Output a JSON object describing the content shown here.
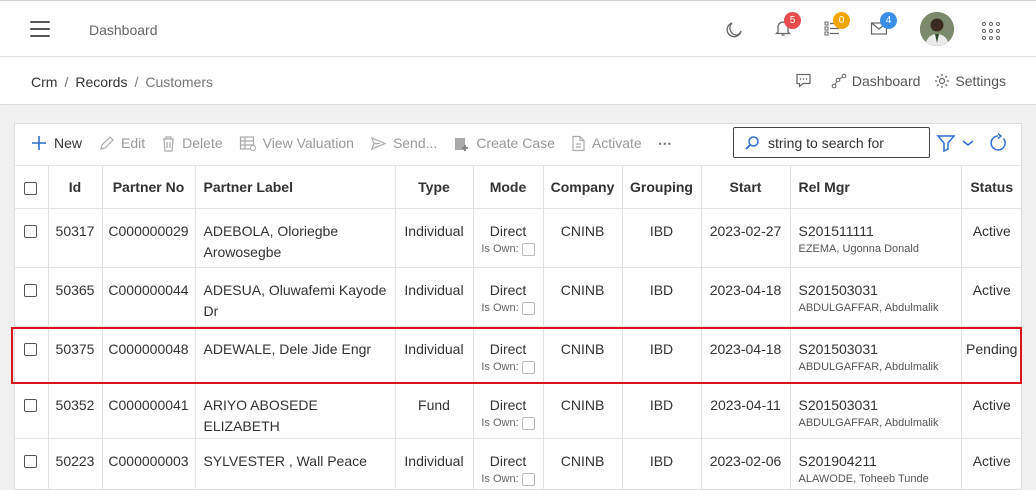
{
  "header": {
    "title": "Dashboard",
    "notifications_count": "5",
    "tasks_count": "0",
    "messages_count": "4",
    "colors": {
      "notifications": "#e84c4c",
      "tasks": "#f0a500",
      "messages": "#3b8fe6"
    }
  },
  "breadcrumb": {
    "items": [
      "Crm",
      "Records",
      "Customers"
    ],
    "actions": {
      "dashboard": "Dashboard",
      "settings": "Settings"
    }
  },
  "toolbar": {
    "new": "New",
    "edit": "Edit",
    "delete": "Delete",
    "view_valuation": "View Valuation",
    "send": "Send...",
    "create_case": "Create Case",
    "activate": "Activate",
    "more": "⋯",
    "search_placeholder": "string to search for"
  },
  "table": {
    "columns": [
      "Id",
      "Partner No",
      "Partner Label",
      "Type",
      "Mode",
      "Company",
      "Grouping",
      "Start",
      "Rel Mgr",
      "Status"
    ],
    "is_own_label": "Is Own:",
    "rows": [
      {
        "id": "50317",
        "partner_no": "C000000029",
        "label": "ADEBOLA, Oloriegbe Arowosegbe",
        "type": "Individual",
        "mode": "Direct",
        "company": "CNINB",
        "grouping": "IBD",
        "start": "2023-02-27",
        "rel_mgr_code": "S201511111",
        "rel_mgr_name": "EZEMA, Ugonna Donald",
        "status": "Active"
      },
      {
        "id": "50365",
        "partner_no": "C000000044",
        "label": "ADESUA, Oluwafemi Kayode Dr",
        "type": "Individual",
        "mode": "Direct",
        "company": "CNINB",
        "grouping": "IBD",
        "start": "2023-04-18",
        "rel_mgr_code": "S201503031",
        "rel_mgr_name": "ABDULGAFFAR, Abdulmalik",
        "status": "Active"
      },
      {
        "id": "50375",
        "partner_no": "C000000048",
        "label": "ADEWALE, Dele Jide Engr",
        "type": "Individual",
        "mode": "Direct",
        "company": "CNINB",
        "grouping": "IBD",
        "start": "2023-04-18",
        "rel_mgr_code": "S201503031",
        "rel_mgr_name": "ABDULGAFFAR, Abdulmalik",
        "status": "Pending"
      },
      {
        "id": "50352",
        "partner_no": "C000000041",
        "label": "ARIYO ABOSEDE ELIZABETH",
        "type": "Fund",
        "mode": "Direct",
        "company": "CNINB",
        "grouping": "IBD",
        "start": "2023-04-11",
        "rel_mgr_code": "S201503031",
        "rel_mgr_name": "ABDULGAFFAR, Abdulmalik",
        "status": "Active"
      },
      {
        "id": "50223",
        "partner_no": "C000000003",
        "label": "SYLVESTER , Wall Peace",
        "type": "Individual",
        "mode": "Direct",
        "company": "CNINB",
        "grouping": "IBD",
        "start": "2023-02-06",
        "rel_mgr_code": "S201904211",
        "rel_mgr_name": "ALAWODE, Toheeb Tunde",
        "status": "Active"
      }
    ]
  }
}
